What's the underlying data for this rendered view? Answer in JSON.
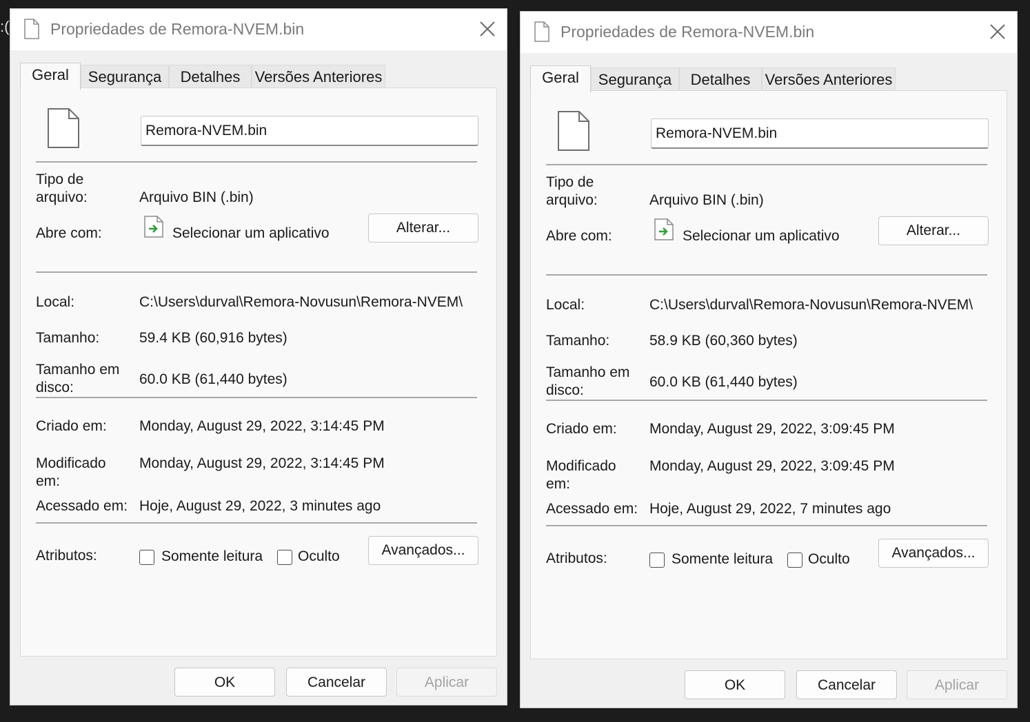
{
  "background": {
    "partial_text": ":("
  },
  "dialogs": [
    {
      "title": "Propriedades de Remora-NVEM.bin",
      "tabs": [
        "Geral",
        "Segurança",
        "Detalhes",
        "Versões Anteriores"
      ],
      "active_tab": "Geral",
      "file_name": "Remora-NVEM.bin",
      "type_label": "Tipo de arquivo:",
      "type_value": "Arquivo BIN (.bin)",
      "opens_label": "Abre com:",
      "opens_value": "Selecionar um aplicativo",
      "change_button": "Alterar...",
      "location_label": "Local:",
      "location_value": "C:\\Users\\durval\\Remora-Novusun\\Remora-NVEM\\",
      "size_label": "Tamanho:",
      "size_value": "59.4 KB (60,916 bytes)",
      "disk_size_label": "Tamanho em disco:",
      "disk_size_value": "60.0 KB (61,440 bytes)",
      "created_label": "Criado em:",
      "created_value": "Monday, August 29, 2022, 3:14:45 PM",
      "modified_label": "Modificado em:",
      "modified_value": "Monday, August 29, 2022, 3:14:45 PM",
      "accessed_label": "Acessado em:",
      "accessed_value": "Hoje, August 29, 2022, 3 minutes ago",
      "attributes_label": "Atributos:",
      "readonly_label": "Somente leitura",
      "readonly_checked": false,
      "hidden_label": "Oculto",
      "hidden_checked": false,
      "advanced_button": "Avançados...",
      "ok_button": "OK",
      "cancel_button": "Cancelar",
      "apply_button": "Aplicar"
    },
    {
      "title": "Propriedades de Remora-NVEM.bin",
      "tabs": [
        "Geral",
        "Segurança",
        "Detalhes",
        "Versões Anteriores"
      ],
      "active_tab": "Geral",
      "file_name": "Remora-NVEM.bin",
      "type_label": "Tipo de arquivo:",
      "type_value": "Arquivo BIN (.bin)",
      "opens_label": "Abre com:",
      "opens_value": "Selecionar um aplicativo",
      "change_button": "Alterar...",
      "location_label": "Local:",
      "location_value": "C:\\Users\\durval\\Remora-Novusun\\Remora-NVEM\\",
      "size_label": "Tamanho:",
      "size_value": "58.9 KB (60,360 bytes)",
      "disk_size_label": "Tamanho em disco:",
      "disk_size_value": "60.0 KB (61,440 bytes)",
      "created_label": "Criado em:",
      "created_value": "Monday, August 29, 2022, 3:09:45 PM",
      "modified_label": "Modificado em:",
      "modified_value": "Monday, August 29, 2022, 3:09:45 PM",
      "accessed_label": "Acessado em:",
      "accessed_value": "Hoje, August 29, 2022, 7 minutes ago",
      "attributes_label": "Atributos:",
      "readonly_label": "Somente leitura",
      "readonly_checked": false,
      "hidden_label": "Oculto",
      "hidden_checked": false,
      "advanced_button": "Avançados...",
      "ok_button": "OK",
      "cancel_button": "Cancelar",
      "apply_button": "Aplicar"
    }
  ],
  "icons": {
    "title": "file-icon",
    "close": "close-icon",
    "file": "file-icon",
    "app": "open-with-app-icon"
  },
  "colors": {
    "title_text": "#7a7a7a",
    "disabled_text": "#a3a3a3",
    "app_icon_arrow": "#2e9e3a"
  }
}
